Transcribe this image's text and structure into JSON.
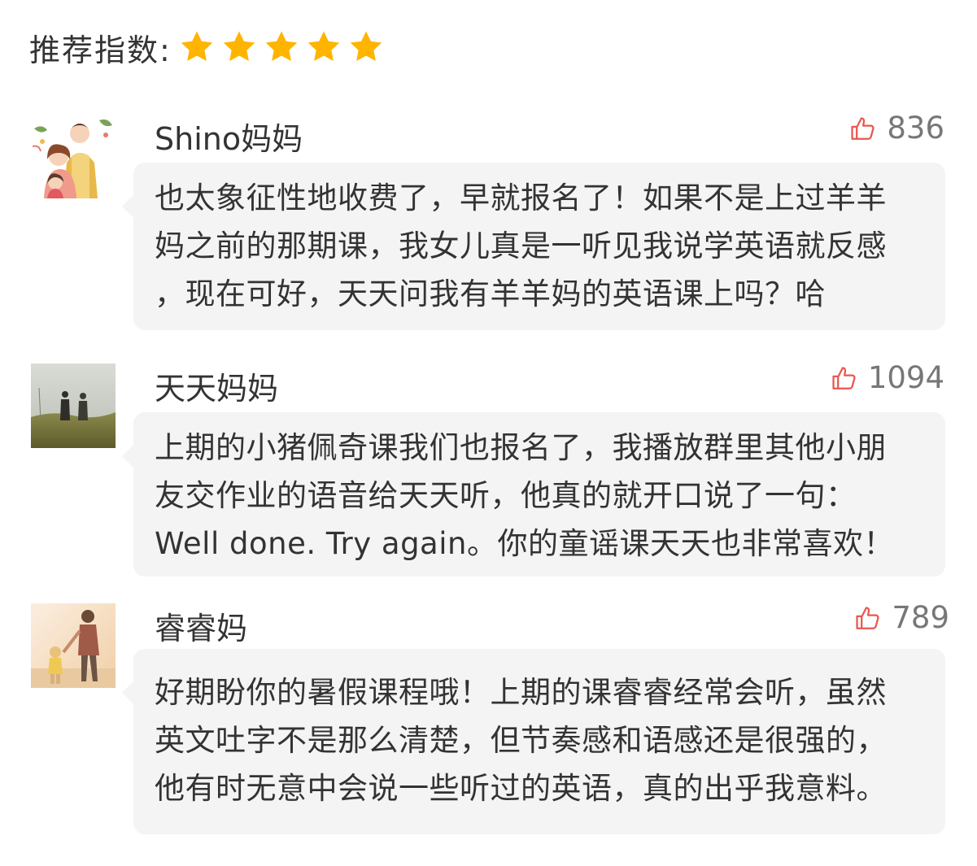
{
  "rating": {
    "label": "推荐指数:",
    "stars": 5,
    "max_stars": 5,
    "star_color": "#FFB400"
  },
  "accent": {
    "like_icon_color": "#E8584E",
    "bubble_bg": "#F4F4F4"
  },
  "comments": [
    {
      "author": "Shino妈妈",
      "likes": "836",
      "avatar_icon": "family-illustration-avatar",
      "text": "也太象征性地收费了，早就报名了！如果不是上过羊羊\n妈之前的那期课，我女儿真是一听见我说学英语就反感\n，现在可好，天天问我有羊羊妈的英语课上吗？哈"
    },
    {
      "author": "天天妈妈",
      "likes": "1094",
      "avatar_icon": "couple-in-field-photo-avatar",
      "text": "上期的小猪佩奇课我们也报名了，我播放群里其他小朋\n友交作业的语音给天天听，他真的就开口说了一句：\nWell done. Try again。你的童谣课天天也非常喜欢！"
    },
    {
      "author": "睿睿妈",
      "likes": "789",
      "avatar_icon": "parent-and-child-beach-photo-avatar",
      "text": "好期盼你的暑假课程哦！上期的课睿睿经常会听，虽然\n英文吐字不是那么清楚，但节奏感和语感还是很强的，\n他有时无意中会说一些听过的英语，真的出乎我意料。"
    }
  ]
}
